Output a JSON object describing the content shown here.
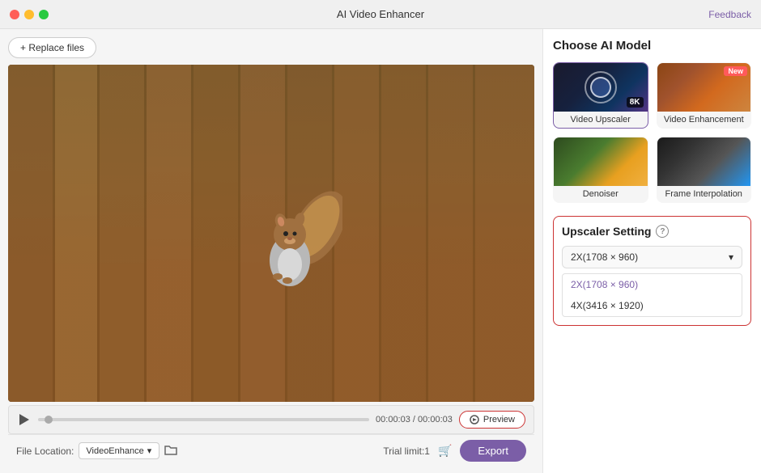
{
  "titleBar": {
    "title": "AI Video Enhancer",
    "feedbackLabel": "Feedback"
  },
  "toolbar": {
    "replaceFilesLabel": "+ Replace files"
  },
  "videoPlayer": {
    "currentTime": "00:00:03",
    "totalTime": "00:00:03",
    "previewLabel": "Preview"
  },
  "bottomBar": {
    "fileLocationLabel": "File Location:",
    "fileLocationValue": "VideoEnhance",
    "trialLabel": "Trial limit:1",
    "exportLabel": "Export"
  },
  "rightPanel": {
    "sectionTitle": "Choose AI Model",
    "models": [
      {
        "id": "video-upscaler",
        "label": "Video Upscaler",
        "badge": "8K",
        "badgeType": "8k",
        "selected": true
      },
      {
        "id": "video-enhancement",
        "label": "Video Enhancement",
        "badge": "New",
        "badgeType": "new",
        "selected": false
      },
      {
        "id": "denoiser",
        "label": "Denoiser",
        "badge": null,
        "selected": false
      },
      {
        "id": "frame-interpolation",
        "label": "Frame Interpolation",
        "badge": null,
        "selected": false
      }
    ],
    "upscalerSetting": {
      "title": "Upscaler Setting",
      "selectedOption": "2X(1708 × 960)",
      "options": [
        "2X(1708 × 960)",
        "4X(3416 × 1920)"
      ],
      "dropdownChevron": "▾"
    }
  }
}
